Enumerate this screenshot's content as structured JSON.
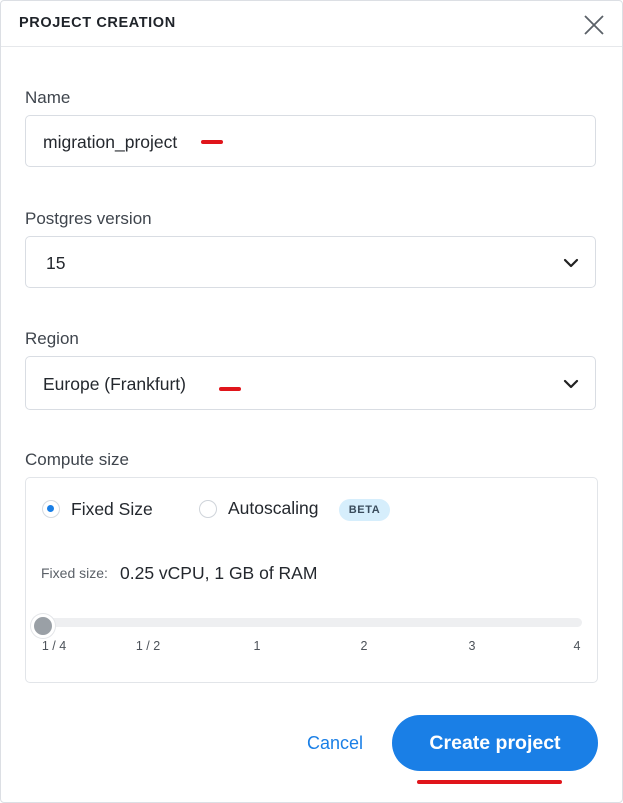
{
  "header": {
    "title": "PROJECT CREATION"
  },
  "name": {
    "label": "Name",
    "value": "migration_project"
  },
  "postgres": {
    "label": "Postgres version",
    "value": "15"
  },
  "region": {
    "label": "Region",
    "value": "Europe (Frankfurt)"
  },
  "compute": {
    "label": "Compute size",
    "options": [
      {
        "label": "Fixed Size",
        "selected": true
      },
      {
        "label": "Autoscaling",
        "selected": false,
        "badge": "BETA"
      }
    ],
    "fixed_caption": "Fixed size:",
    "fixed_value": "0.25 vCPU, 1 GB of RAM",
    "slider": {
      "ticks": [
        "1 / 4",
        "1 / 2",
        "1",
        "2",
        "3",
        "4"
      ],
      "selected": "1 / 4"
    }
  },
  "actions": {
    "cancel": "Cancel",
    "create": "Create project"
  },
  "colors": {
    "accent": "#1a7fe6",
    "annotation": "#e0151b"
  },
  "icons": {
    "close": "close-icon",
    "select": "chevron-down-icon"
  }
}
